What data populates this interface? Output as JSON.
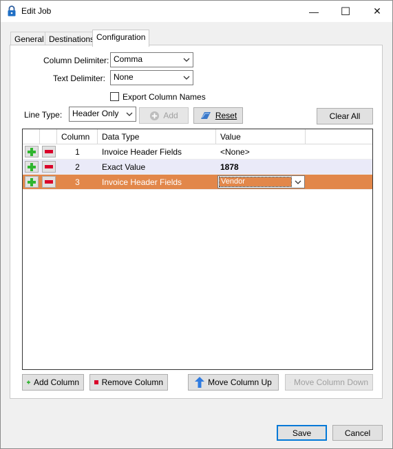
{
  "window": {
    "title": "Edit Job",
    "minimize": "—",
    "maximize": "☐",
    "close": "✕"
  },
  "tabs": [
    {
      "label": "General",
      "active": false
    },
    {
      "label": "Destinations",
      "active": false
    },
    {
      "label": "Configuration",
      "active": true
    }
  ],
  "config": {
    "column_delimiter_label": "Column Delimiter:",
    "column_delimiter_value": "Comma",
    "text_delimiter_label": "Text Delimiter:",
    "text_delimiter_value": "None",
    "export_column_names_label": "Export Column Names",
    "export_column_names_checked": false,
    "line_type_label": "Line Type:",
    "line_type_value": "Header Only",
    "add_label": "Add",
    "reset_label": "Reset",
    "clear_all_label": "Clear All"
  },
  "grid": {
    "columns": [
      "Column",
      "Data Type",
      "Value"
    ],
    "rows": [
      {
        "column": "1",
        "data_type": "Invoice Header Fields",
        "value": "<None>"
      },
      {
        "column": "2",
        "data_type": "Exact Value",
        "value": "1878"
      },
      {
        "column": "3",
        "data_type": "Invoice Header Fields",
        "value": "Vendor"
      }
    ],
    "selected_row": 3
  },
  "bottom_buttons": {
    "add_column": "Add Column",
    "remove_column": "Remove Column",
    "move_up": "Move Column Up",
    "move_down": "Move Column Down"
  },
  "footer": {
    "save": "Save",
    "cancel": "Cancel"
  },
  "colors": {
    "selection": "#e2874a",
    "alt_row": "#eaeaf8",
    "add_green": "#2fb52f",
    "remove_red": "#d9002a",
    "focus_blue": "#0078d7"
  }
}
